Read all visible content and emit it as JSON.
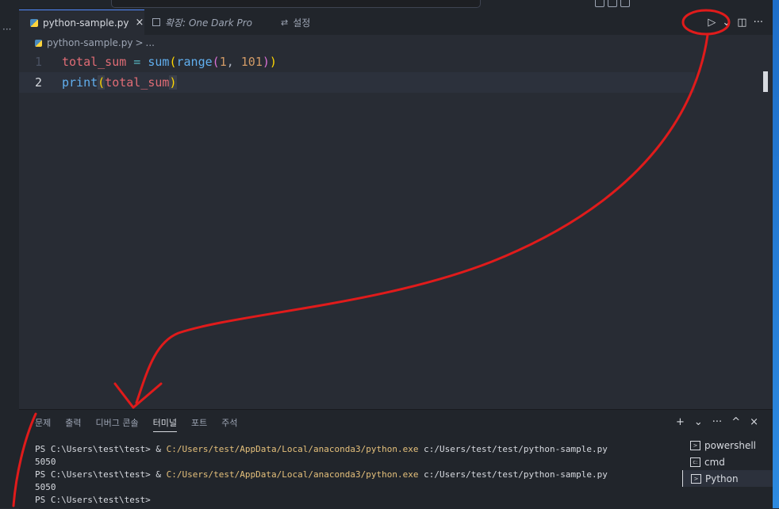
{
  "tabs": [
    {
      "label": "python-sample.py",
      "close": "×",
      "active": true
    },
    {
      "label": "확장: One Dark Pro",
      "active": false
    },
    {
      "label": "설정",
      "active": false
    }
  ],
  "tab_actions": {
    "run": "▷",
    "run_menu": "⌄",
    "split": "◫",
    "more": "···"
  },
  "breadcrumb": {
    "file": "python-sample.py",
    "separator": ">",
    "rest": "..."
  },
  "editor": {
    "lines": [
      {
        "number": "1",
        "tokens": {
          "t1": "total_sum",
          "t2": " = ",
          "t3": "sum",
          "t4": "(",
          "t5": "range",
          "t6": "(",
          "t7": "1",
          "t8": ", ",
          "t9": "101",
          "t10": ")",
          "t11": ")"
        }
      },
      {
        "number": "2",
        "tokens": {
          "t1": "print",
          "t2": "(",
          "t3": "total_sum",
          "t4": ")"
        }
      }
    ]
  },
  "panel": {
    "tabs": [
      "문제",
      "출력",
      "디버그 콘솔",
      "터미널",
      "포트",
      "주석"
    ],
    "active_tab": "터미널",
    "actions": {
      "add": "+",
      "dropdown": "⌄",
      "more": "···",
      "maximize": "^",
      "close": "×"
    }
  },
  "terminal": {
    "lines": [
      {
        "prompt": "PS C:\\Users\\test\\test> & ",
        "exe": "C:/Users/test/AppData/Local/anaconda3/python.exe",
        "arg": " c:/Users/test/test/python-sample.py"
      },
      {
        "output": "5050"
      },
      {
        "prompt": "PS C:\\Users\\test\\test> & ",
        "exe": "C:/Users/test/AppData/Local/anaconda3/python.exe",
        "arg": " c:/Users/test/test/python-sample.py"
      },
      {
        "output": "5050"
      },
      {
        "prompt": "PS C:\\Users\\test\\test>"
      }
    ],
    "instances": [
      {
        "label": "powershell",
        "icon": "terminal-icon"
      },
      {
        "label": "cmd",
        "icon": "cmd-icon"
      },
      {
        "label": "Python",
        "icon": "terminal-icon",
        "selected": true
      }
    ]
  },
  "colors": {
    "annotation": "#e01b1b",
    "accent": "#528bff"
  }
}
